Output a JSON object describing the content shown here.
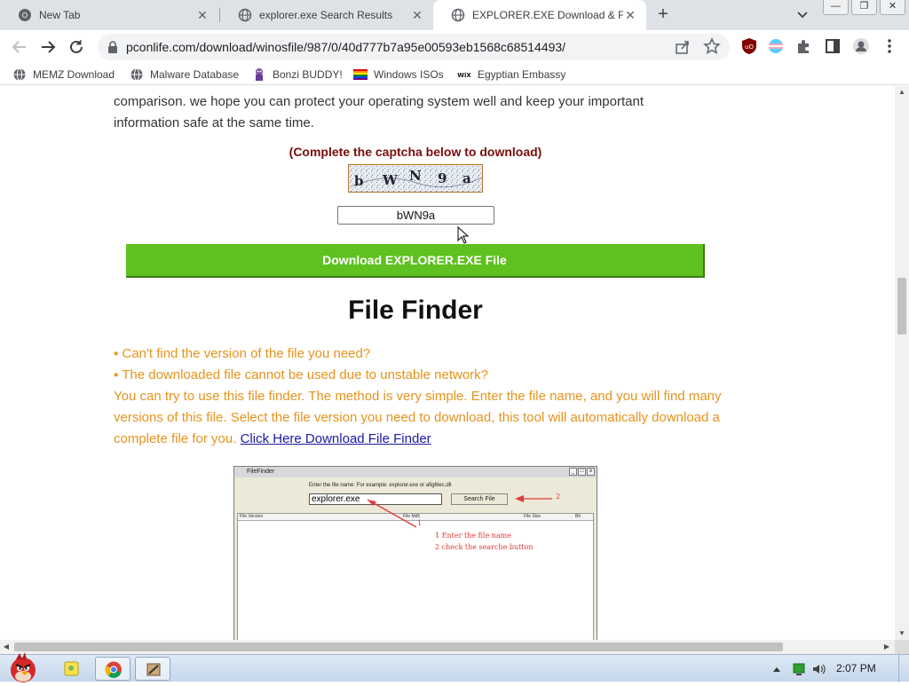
{
  "tabs": [
    {
      "title": "New Tab",
      "icon": "chrome-icon"
    },
    {
      "title": "explorer.exe Search Results",
      "icon": "globe-icon"
    },
    {
      "title": "EXPLORER.EXE Download & Fix F",
      "icon": "globe-icon",
      "active": true
    }
  ],
  "window_buttons": {
    "minimize": "—",
    "restore": "❐",
    "close": "✕"
  },
  "omnibox": {
    "url": "pconlife.com/download/winosfile/987/0/40d777b7a95e00593eb1568c68514493/"
  },
  "bookmarks": [
    {
      "label": "MEMZ Download",
      "icon": "globe-icon"
    },
    {
      "label": "Malware Database",
      "icon": "globe-icon"
    },
    {
      "label": "Bonzi BUDDY!",
      "icon": "bonzi-icon"
    },
    {
      "label": "Windows ISOs",
      "icon": "windows-flag-icon"
    },
    {
      "label": "Egyptian Embassy",
      "icon": "wix-icon"
    }
  ],
  "page": {
    "intro_line1": "comparison. we hope you can protect your operating system well and keep your important",
    "intro_line2": "information safe at the same time.",
    "captcha_title": "(Complete the captcha below to download)",
    "captcha_chars": [
      "b",
      "W",
      "N",
      "9",
      "a"
    ],
    "captcha_value": "bWN9a",
    "download_button": "Download EXPLORER.EXE File",
    "file_finder_title": "File Finder",
    "bullet1": "▪ Can't find the version of the file you need?",
    "bullet2": "▪ The downloaded file cannot be used due to unstable network?",
    "finder_desc": "You can try to use this file finder. The method is very simple. Enter the file name, and you will find many versions of this file. Select the file version you need to download, this tool will automatically download a complete file for you.",
    "finder_link": "Click Here Download File Finder",
    "screenshot": {
      "window_title": "FileFinder",
      "hint": "Enter the file name:  For example: explorer.exe or afig6tec.dll",
      "input_value": "explorer.exe",
      "search_button": "Search File",
      "col_version": "File Version",
      "col_md5": "File Md5",
      "col_size": "File Size",
      "col_bit": "Bit",
      "annot_num1": "1",
      "annot_num2": "2",
      "annot_step1": "1 Enter the file name",
      "annot_step2": "2 check the searche button"
    }
  },
  "taskbar": {
    "clock": "2:07 PM"
  },
  "colors": {
    "download_green": "#5ec11f",
    "orange_text": "#e6931c",
    "captcha_red": "#7a0c0c",
    "link_blue": "#1a1aa6"
  }
}
